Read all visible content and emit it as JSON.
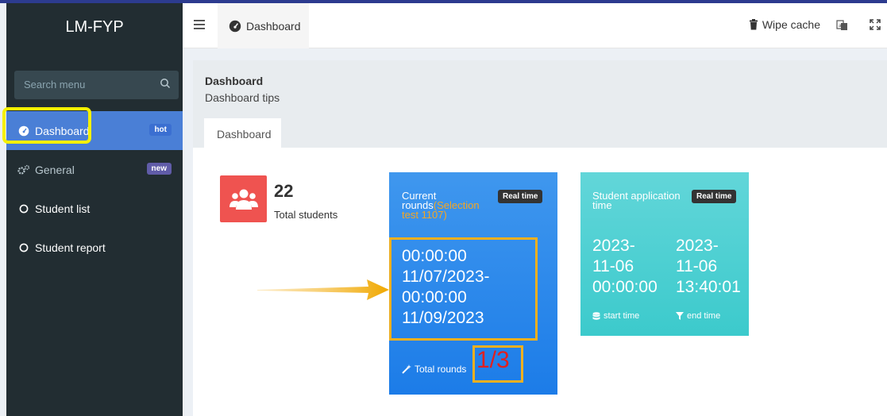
{
  "app": {
    "title": "LM-FYP"
  },
  "search": {
    "placeholder": "Search menu"
  },
  "sidebar": {
    "items": [
      {
        "label": "Dashboard",
        "badge": "hot",
        "icon": "dashboard-icon",
        "active": true
      },
      {
        "label": "General",
        "badge": "new",
        "icon": "gears-icon"
      },
      {
        "label": "Student list",
        "icon": "circle-icon"
      },
      {
        "label": "Student report",
        "icon": "circle-icon"
      }
    ]
  },
  "header": {
    "tab_label": "Dashboard",
    "wipe_cache": "Wipe cache"
  },
  "content": {
    "title": "Dashboard",
    "tips": "Dashboard tips",
    "tab": "Dashboard"
  },
  "stats": {
    "total_students_value": "22",
    "total_students_label": "Total students"
  },
  "rounds_card": {
    "title": "Current rounds",
    "selection": "(Selection test 1107)",
    "badge": "Real time",
    "times": [
      "00:00:00",
      "11/07/2023-",
      "00:00:00",
      "11/09/2023"
    ],
    "footer_label": "Total rounds",
    "rounds_value": "1/3"
  },
  "application_card": {
    "title": "Student application time",
    "badge": "Real time",
    "start": [
      "2023-",
      "11-06",
      "00:00:00"
    ],
    "end": [
      "2023-",
      "11-06",
      "13:40:01"
    ],
    "start_label": "start time",
    "end_label": "end time"
  },
  "colors": {
    "sidebar_bg": "#222d32",
    "active_item": "#4a7fd6",
    "highlight": "#f5f000",
    "annotation": "#f0b020",
    "rounds_value": "#e02020",
    "blue_card": "#2a89ec",
    "teal_card": "#4fd0d2",
    "students_icon_bg": "#ef5350"
  }
}
